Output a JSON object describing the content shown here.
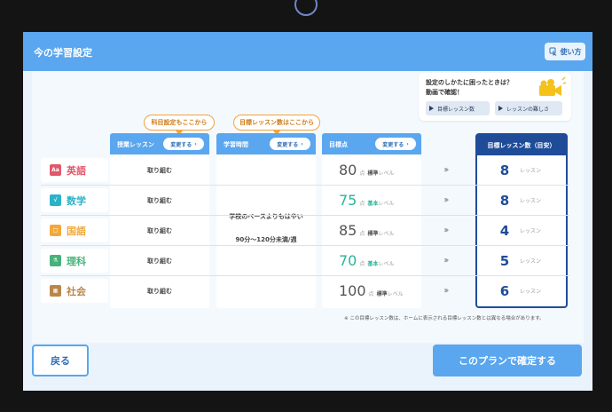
{
  "header": {
    "title": "今の学習設定",
    "howto_label": "使い方"
  },
  "help": {
    "line1": "設定のしかたに困ったときは？",
    "line2": "動画で確認！",
    "video1": "目標レッスン数",
    "video2": "レッスンの難しさ"
  },
  "callouts": {
    "subject": "科目設定もここから",
    "target": "目標レッスン数はここから"
  },
  "columns": {
    "lesson": {
      "label": "授業レッスン",
      "change": "変更する"
    },
    "study_time": {
      "label": "学習時間",
      "change": "変更する"
    },
    "target_score": {
      "label": "目標点",
      "change": "変更する"
    },
    "target_lessons": {
      "label": "目標レッスン数（目安）"
    }
  },
  "study_time": {
    "line1": "学校のペースよりもはやい",
    "line2": "90分〜120分未満/週"
  },
  "score_unit": "点",
  "level_suffix": "レベル",
  "lesson_unit": "レッスン",
  "subjects": [
    {
      "name": "英語",
      "icon": "Aa",
      "color": "#e0596b",
      "lesson": "取り組む",
      "score": "80",
      "score_color": "#555555",
      "level": "標準",
      "target": "8"
    },
    {
      "name": "数学",
      "icon": "√",
      "color": "#2ab3c8",
      "lesson": "取り組む",
      "score": "75",
      "score_color": "#2bb39a",
      "level": "基本",
      "target": "8"
    },
    {
      "name": "国語",
      "icon": "□",
      "color": "#f1a93b",
      "lesson": "取り組む",
      "score": "85",
      "score_color": "#555555",
      "level": "標準",
      "target": "4"
    },
    {
      "name": "理科",
      "icon": "⚗",
      "color": "#46b37a",
      "lesson": "取り組む",
      "score": "70",
      "score_color": "#2bb39a",
      "level": "基本",
      "target": "5"
    },
    {
      "name": "社会",
      "icon": "▦",
      "color": "#b9864a",
      "lesson": "取り組む",
      "score": "100",
      "score_color": "#555555",
      "level": "標準",
      "target": "6"
    }
  ],
  "note": "※ この目標レッスン数は、ホームに表示される目標レッスン数とは異なる場合があります。",
  "footer": {
    "back": "戻る",
    "confirm": "このプランで確定する"
  }
}
